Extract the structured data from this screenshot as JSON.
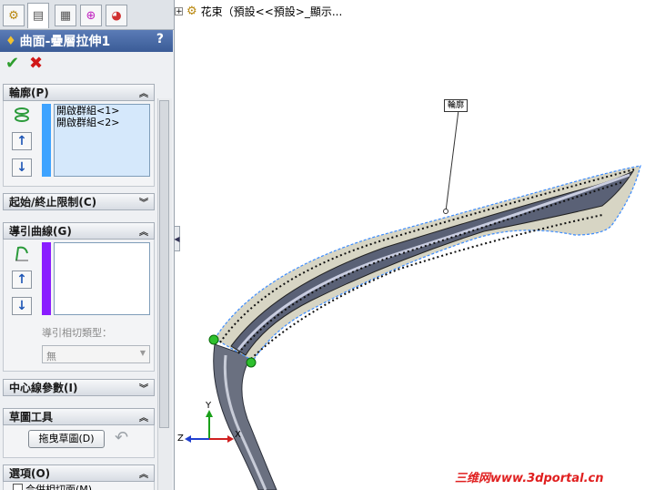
{
  "window": {
    "tree_path": "花束（預設<<預設>_顯示..."
  },
  "panel": {
    "title": "曲面-疊層拉伸1",
    "help": "?",
    "ok_glyph": "✔",
    "cancel_glyph": "✖",
    "sections": {
      "profile": {
        "header": "輪廓(P)",
        "items": [
          "開啟群組<1>",
          "開啟群組<2>"
        ],
        "state": "expanded"
      },
      "constraints": {
        "header": "起始/終止限制(C)",
        "state": "collapsed"
      },
      "guides": {
        "header": "導引曲線(G)",
        "items": [],
        "tangency_label": "導引相切類型：",
        "tangency_value": "無",
        "state": "expanded"
      },
      "centerline": {
        "header": "中心線參數(I)",
        "state": "collapsed"
      },
      "sketch_tools": {
        "header": "草圖工具",
        "drag_button": "拖曳草圖(D)",
        "undo_glyph": "↶",
        "state": "expanded"
      },
      "options": {
        "header": "選項(O)",
        "partial_text": "合併相切面(M)",
        "state": "expanded"
      }
    }
  },
  "graphics": {
    "callout_label": "輪廓",
    "triad": {
      "x": "X",
      "y": "Y",
      "z": "Z"
    },
    "watermark": "三维网www.3dportal.cn"
  },
  "colors": {
    "title_bar": "#3b5c97",
    "profile_bar": "#3ea3ff",
    "guide_bar": "#8a1cff",
    "watermark": "#e02020"
  }
}
